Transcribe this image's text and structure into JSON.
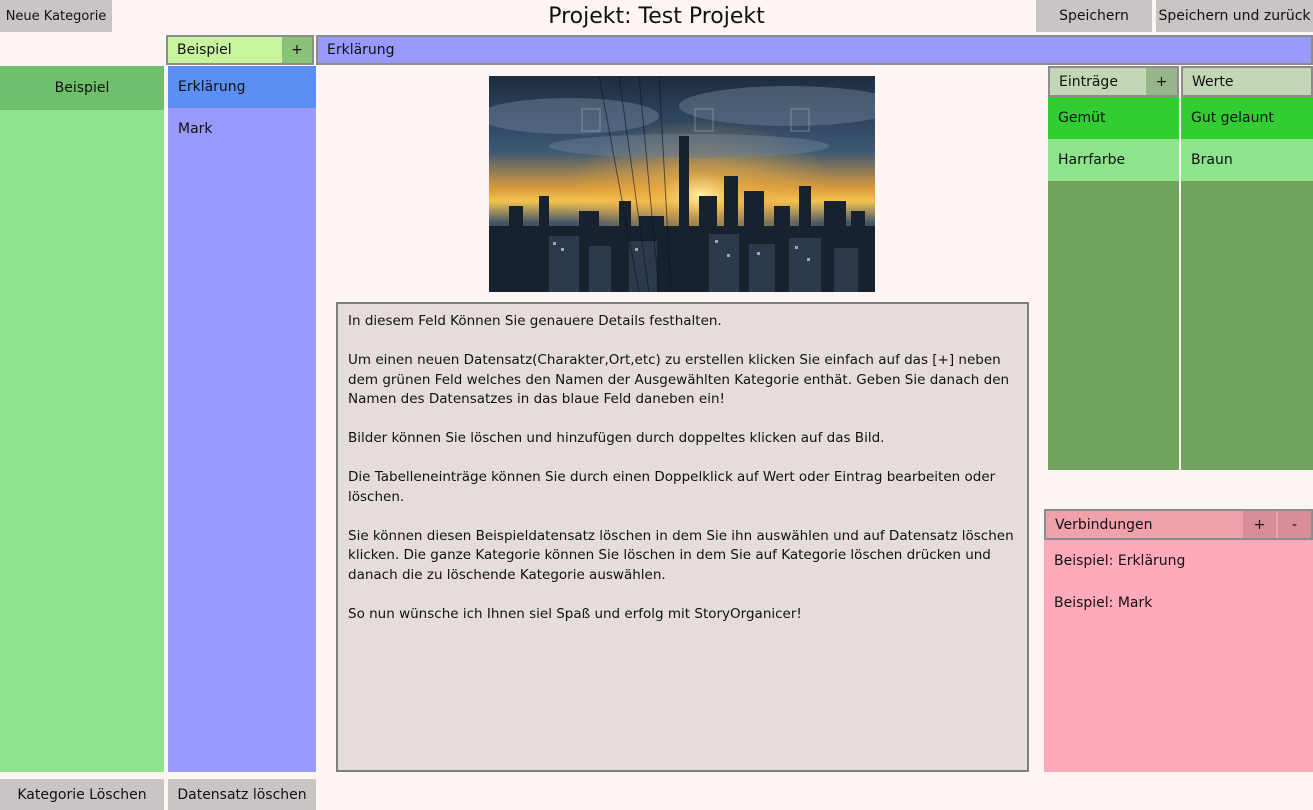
{
  "header": {
    "title": "Projekt: Test Projekt",
    "new_category_label": "Neue Kategorie",
    "save_label": "Speichern",
    "save_back_label": "Speichern und zurück"
  },
  "categories": {
    "header_label": "Beispiel",
    "header_plus": "+",
    "items": [
      {
        "label": "Beispiel",
        "selected": true
      }
    ],
    "delete_label": "Kategorie Löschen"
  },
  "records": {
    "items": [
      {
        "label": "Erklärung",
        "selected": true
      },
      {
        "label": "Mark",
        "selected": false
      }
    ],
    "delete_label": "Datensatz löschen"
  },
  "detail": {
    "name_value": "Erklärung",
    "text": "In diesem Feld Können Sie genauere Details festhalten.\n\nUm einen neuen Datensatz(Charakter,Ort,etc) zu erstellen klicken Sie einfach auf das [+] neben dem grünen Feld welches den Namen der Ausgewählten Kategorie enthät. Geben Sie danach den Namen des Datensatzes in das blaue Feld daneben ein!\n\nBilder können Sie löschen und hinzufügen durch doppeltes klicken auf das Bild.\n\nDie Tabelleneinträge können Sie durch einen Doppelklick auf Wert oder Eintrag bearbeiten oder löschen.\n\nSie können diesen Beispieldatensatz löschen in dem Sie ihn auswählen und auf Datensatz löschen klicken. Die ganze Kategorie können Sie löschen in dem Sie auf Kategorie löschen drücken und danach die zu löschende Kategorie auswählen.\n\nSo nun wünsche ich Ihnen siel Spaß und erfolg mit StoryOrganicer!"
  },
  "table": {
    "entries_header": "Einträge",
    "plus": "+",
    "values_header": "Werte",
    "rows": [
      {
        "entry": "Gemüt",
        "value": "Gut gelaunt"
      },
      {
        "entry": "Harrfarbe",
        "value": "Braun"
      }
    ]
  },
  "connections": {
    "header": "Verbindungen",
    "plus": "+",
    "minus": "-",
    "items": [
      "Beispiel: Erklärung",
      "Beispiel: Mark"
    ]
  },
  "colors": {
    "category_green": "#8de48a",
    "record_blue": "#9a99fe",
    "record_selected": "#5c8ff3",
    "table_green": "#70a35e",
    "connections_pink": "#ffaabb"
  }
}
